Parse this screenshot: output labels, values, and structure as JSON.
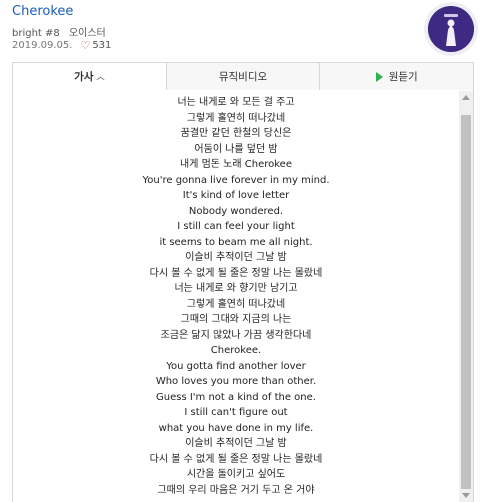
{
  "song": {
    "title": "Cherokee",
    "track": "bright #8",
    "artist": "오이스터",
    "date": "2019.09.05.",
    "likes": "531"
  },
  "icons": {
    "like": "heart-icon",
    "play": "play-icon",
    "sort": "chevron-up-icon"
  },
  "colors": {
    "title_link": "#1a5fb4",
    "heart": "#e53935",
    "play": "#2bb24c",
    "album_bg": "#3e2a82"
  },
  "tabs": [
    {
      "label": "가사",
      "active": true
    },
    {
      "label": "뮤직비디오",
      "active": false
    },
    {
      "label": "원듣기",
      "active": false
    }
  ],
  "lyrics": [
    "너는 내게로 와 모든 걸 주고",
    "그렇게 홀연히 떠나갔네",
    "꿈결만 같던 한철의 당신은",
    "어둠이 나를 덮던 밤",
    "내게 멈돈 노래 Cherokee",
    "You're gonna live forever in my mind.",
    "It's kind of love letter",
    "Nobody wondered.",
    "I still can feel your light",
    "it seems to beam me all night.",
    "이슬비 추적이던 그날 밤",
    "다시 볼 수 없게 될 줄은 정말 나는 몰랐네",
    "너는 내게로 와 향기만 남기고",
    "그렇게 홀연히 떠나갔네",
    "그때의 그대와 지금의 나는",
    "조금은 닮지 않았나 가끔 생각한다네",
    "Cherokee.",
    "You gotta find another lover",
    "Who loves you more than other.",
    "Guess I'm not a kind of the one.",
    "I still can't figure out",
    "what you have done in my life.",
    "이슬비 추적이던 그날 밤",
    "다시 볼 수 없게 될 줄은 정말 나는 몰랐네",
    "시간을 돌이키고 싶어도",
    "그때의 우리 마음은 거기 두고 온 거야"
  ]
}
